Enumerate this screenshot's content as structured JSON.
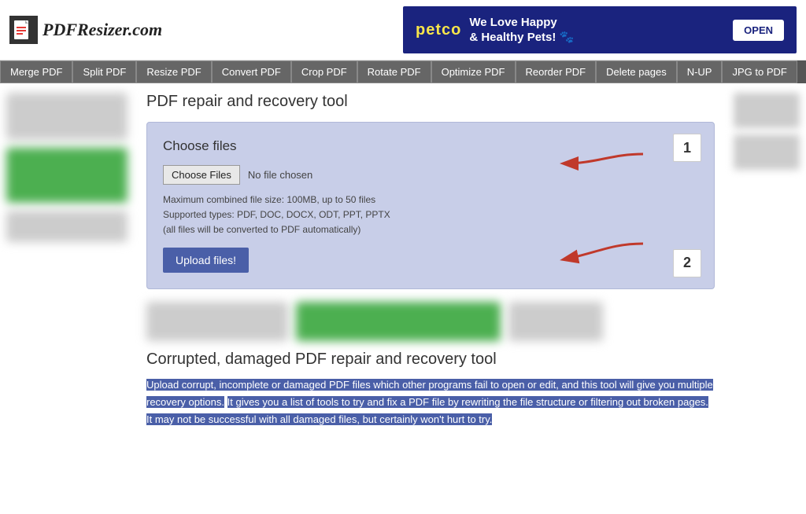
{
  "header": {
    "logo_text": "PDFResizer.com",
    "ad": {
      "brand": "petco",
      "tagline": "We Love Happy\n& Healthy Pets!",
      "open_label": "OPEN"
    }
  },
  "nav": {
    "items": [
      "Merge PDF",
      "Split PDF",
      "Resize PDF",
      "Convert PDF",
      "Crop PDF",
      "Rotate PDF",
      "Optimize PDF",
      "Reorder PDF",
      "Delete pages",
      "N-UP",
      "JPG to PDF"
    ]
  },
  "page": {
    "title": "PDF repair and recovery tool",
    "upload_box": {
      "choose_files_label": "Choose files",
      "choose_files_btn": "Choose Files",
      "no_file_text": "No file chosen",
      "file_info_line1": "Maximum combined file size: 100MB, up to 50 files",
      "file_info_line2": "Supported types: PDF, DOC, DOCX, ODT, PPT, PPTX",
      "file_info_line3": "(all files will be converted to PDF automatically)",
      "upload_btn_label": "Upload files!",
      "step1": "1",
      "step2": "2"
    },
    "bottom_title": "Corrupted, damaged PDF repair and recovery tool",
    "bottom_text_1": "Upload corrupt, incomplete or damaged PDF files which other programs fail to open or edit, and this tool will give you multiple recovery options.",
    "bottom_text_2": "It gives you a list of tools to try and fix a PDF file by rewriting the file structure or filtering out broken pages.",
    "bottom_text_3": "It may not be successful with all damaged files, but certainly won't hurt to try."
  }
}
